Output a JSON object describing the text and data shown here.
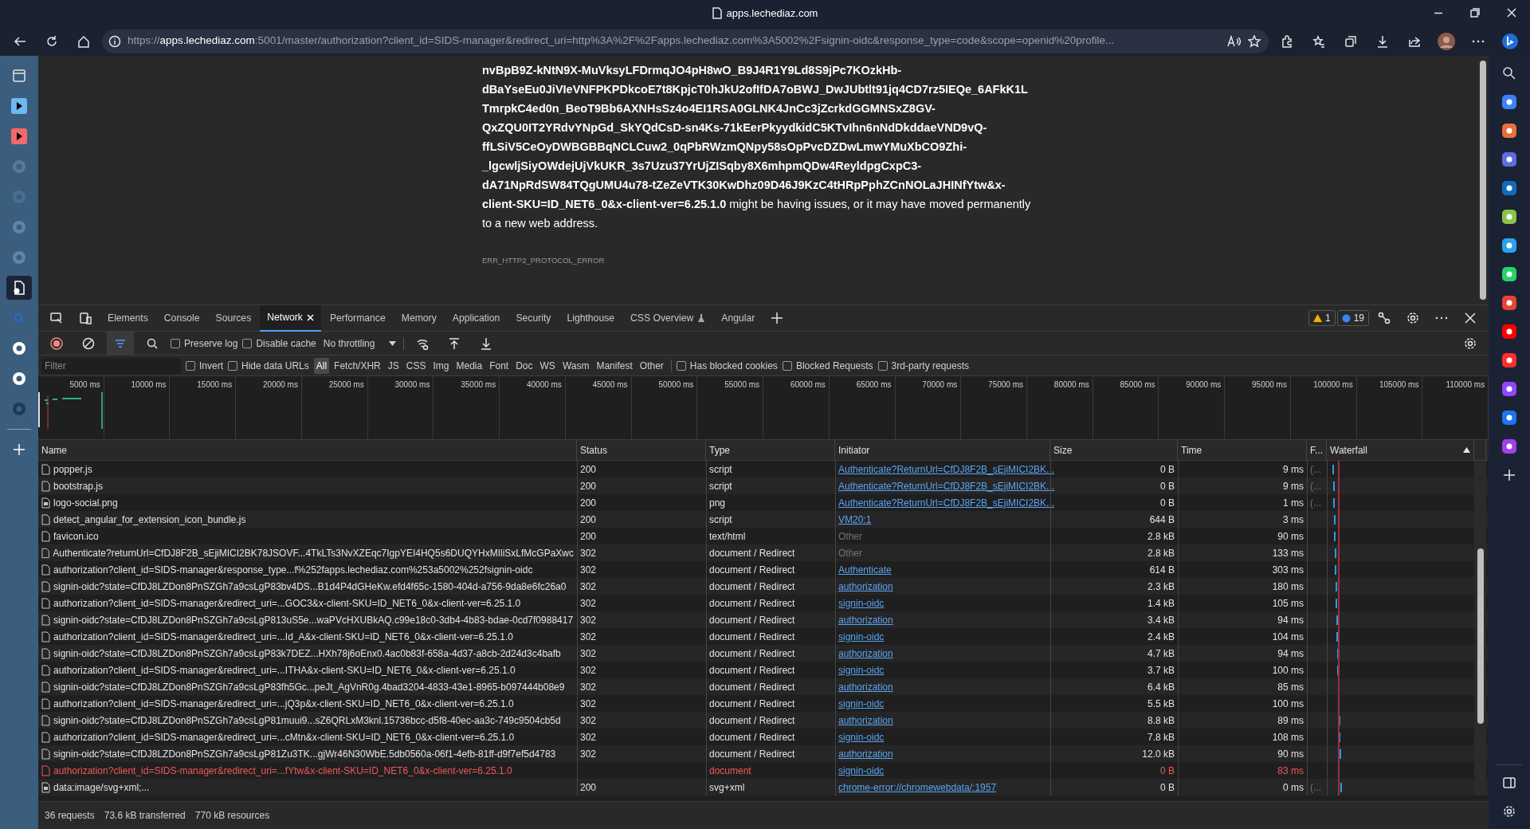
{
  "browser": {
    "title": "apps.lechediaz.com",
    "url_scheme": "https://",
    "url_host": "apps.lechediaz.com",
    "url_rest": ":5001/master/authorization?client_id=SIDS-manager&redirect_uri=http%3A%2F%2Fapps.lechediaz.com%3A5002%2Fsignin-oidc&response_type=code&scope=openid%20profile..."
  },
  "left_sidebar": {
    "items": [
      {
        "kind": "tabs",
        "selected": false
      },
      {
        "kind": "play",
        "color": "#6cb8f0",
        "selected": false
      },
      {
        "kind": "play",
        "color": "#f06a6a",
        "selected": false
      },
      {
        "kind": "app",
        "color": "#5c7a98",
        "selected": false
      },
      {
        "kind": "app",
        "color": "#4a6f94",
        "selected": false
      },
      {
        "kind": "app",
        "color": "#5a86b0",
        "selected": false
      },
      {
        "kind": "app",
        "color": "#5a86b0",
        "selected": false
      },
      {
        "kind": "document",
        "selected": true
      },
      {
        "kind": "search",
        "selected": false
      },
      {
        "kind": "app",
        "color": "#ffffff",
        "selected": false
      },
      {
        "kind": "app",
        "color": "#ffffff",
        "selected": false
      },
      {
        "kind": "app",
        "color": "#1e3a54",
        "selected": false
      }
    ]
  },
  "right_sidebar": {
    "items": [
      {
        "kind": "search"
      },
      {
        "kind": "app",
        "color": "#3b82f6"
      },
      {
        "kind": "app",
        "color": "#e8703a"
      },
      {
        "kind": "app",
        "color": "#5b6ee1"
      },
      {
        "kind": "app",
        "color": "#0f6cbd"
      },
      {
        "kind": "app",
        "color": "#8bc34a"
      },
      {
        "kind": "app",
        "color": "#2aa3ef"
      },
      {
        "kind": "app",
        "color": "#25d366"
      },
      {
        "kind": "app",
        "color": "#ea4335"
      },
      {
        "kind": "app",
        "color": "#ff0000"
      },
      {
        "kind": "app",
        "color": "#ff2d2d"
      },
      {
        "kind": "app",
        "color": "#9146ff"
      },
      {
        "kind": "app",
        "color": "#1877f2"
      },
      {
        "kind": "app",
        "color": "#a040f0"
      },
      {
        "kind": "plus"
      }
    ]
  },
  "page": {
    "message": "**nvBpB9Z-kNtN9X-MuVksyLFDrmqJO4pH8wO_B9J4R1Y9Ld8S9jPc7KOzkHb-dBaYseEu0JiVIeVNFPKPDkcoE7t8KpjcT0hJkU2ofIfDA7oBWJ_DwJUbtlt91jq4CD7rz5IEQe_6AFkK1LTmrpkC4ed0n_BeoT9Bb6AXNHsSz4o4EI1RSA0GLNK4JnCc3jZcrkdGGMNSxZ8GV-QxZQU0IT2YRdvYNpGd_SkYQdCsD-sn4Ks-71kEerPkyydkidC5KTvIhn6nNdDkddaeVND9vQ-ffLSiV5CeOyDWBGBBqNCLCuw2_0qPbRWzmQNpy58sOpPvcDZDwLmwYMuXbCO9Zhi-_lgcwljSiyOWdejUjVkUKR_3s7Uzu37YrUjZISqby8X6mhpmQDw4ReyldpgCxpC3-dA71NpRdSW84TQgUMU4u78-tZeZeVTK30KwDhz09D46J9KzC4tHRpPphZCnNOLaJHINfYtw&x-client-SKU=ID_NET6_0&x-client-ver=6.25.1.0** might be having issues, or it may have moved permanently to a new web address.",
    "error_code": "ERR_HTTP2_PROTOCOL_ERROR"
  },
  "devtools": {
    "tabs": [
      {
        "label": "Elements",
        "selected": false
      },
      {
        "label": "Console",
        "selected": false
      },
      {
        "label": "Sources",
        "selected": false
      },
      {
        "label": "Network",
        "selected": true
      },
      {
        "label": "Performance",
        "selected": false
      },
      {
        "label": "Memory",
        "selected": false
      },
      {
        "label": "Application",
        "selected": false
      },
      {
        "label": "Security",
        "selected": false
      },
      {
        "label": "Lighthouse",
        "selected": false
      },
      {
        "label": "CSS Overview",
        "selected": false,
        "kind": "experimental"
      },
      {
        "label": "Angular",
        "selected": false
      }
    ],
    "warnings": "1",
    "messages": "19",
    "toolbar": {
      "recording": true,
      "preserve_log": false,
      "disable_cache": false,
      "labels": [
        "Preserve log",
        "Disable cache"
      ],
      "throttling": "No throttling"
    },
    "filter": {
      "placeholder": "Filter",
      "invert": false,
      "hide_data_urls": false,
      "types": [
        {
          "label": "All",
          "selected": true
        },
        {
          "label": "Fetch/XHR",
          "selected": false
        },
        {
          "label": "JS",
          "selected": false
        },
        {
          "label": "CSS",
          "selected": false
        },
        {
          "label": "Img",
          "selected": false
        },
        {
          "label": "Media",
          "selected": false
        },
        {
          "label": "Font",
          "selected": false
        },
        {
          "label": "Doc",
          "selected": false
        },
        {
          "label": "WS",
          "selected": false
        },
        {
          "label": "Wasm",
          "selected": false
        },
        {
          "label": "Manifest",
          "selected": false
        },
        {
          "label": "Other",
          "selected": false
        }
      ],
      "has_blocked_cookies": false,
      "blocked_requests": false,
      "third_party_requests": false,
      "labels": [
        "Invert",
        "Hide data URLs",
        "Has blocked cookies",
        "Blocked Requests",
        "3rd-party requests"
      ]
    },
    "overview_ticks": [
      "5000 ms",
      "10000 ms",
      "15000 ms",
      "20000 ms",
      "25000 ms",
      "30000 ms",
      "35000 ms",
      "40000 ms",
      "45000 ms",
      "50000 ms",
      "55000 ms",
      "60000 ms",
      "65000 ms",
      "70000 ms",
      "75000 ms",
      "80000 ms",
      "85000 ms",
      "90000 ms",
      "95000 ms",
      "100000 ms",
      "105000 ms",
      "110000 ms"
    ],
    "table": {
      "columns": [
        "Name",
        "Status",
        "Type",
        "Initiator",
        "Size",
        "Time",
        "F...",
        "Waterfall"
      ],
      "rows": [
        {
          "kind": "document",
          "name": "popper.js",
          "status": "200",
          "type": "script",
          "initiator": "Authenticate?ReturnUrl=CfDJ8F2B_sEjiMICI2BK...",
          "initiator_link": true,
          "size": "0 B",
          "time": "9 ms",
          "column_7": "(...",
          "error": false
        },
        {
          "kind": "document",
          "name": "bootstrap.js",
          "status": "200",
          "type": "script",
          "initiator": "Authenticate?ReturnUrl=CfDJ8F2B_sEjiMICI2BK...",
          "initiator_link": true,
          "size": "0 B",
          "time": "9 ms",
          "column_7": "(...",
          "error": false
        },
        {
          "kind": "image",
          "name": "logo-social.png",
          "status": "200",
          "type": "png",
          "initiator": "Authenticate?ReturnUrl=CfDJ8F2B_sEjiMICI2BK...",
          "initiator_link": true,
          "size": "0 B",
          "time": "1 ms",
          "column_7": "(...",
          "error": false
        },
        {
          "kind": "document",
          "name": "detect_angular_for_extension_icon_bundle.js",
          "status": "200",
          "type": "script",
          "initiator": "VM20:1",
          "initiator_link": true,
          "size": "644 B",
          "time": "3 ms",
          "error": false
        },
        {
          "kind": "document",
          "name": "favicon.ico",
          "status": "200",
          "type": "text/html",
          "initiator": "Other",
          "initiator_link": false,
          "size": "2.8 kB",
          "time": "90 ms",
          "error": false
        },
        {
          "kind": "document",
          "name": "Authenticate?returnUrl=CfDJ8F2B_sEjiMICI2BK78JSOVF...4TkLTs3NvXZEqc7IgpYEI4HQ5s6DUQYHxMIliSxLfMcGPaXwc",
          "status": "302",
          "type": "document / Redirect",
          "initiator": "Other",
          "initiator_link": false,
          "size": "2.8 kB",
          "time": "133 ms",
          "error": false
        },
        {
          "kind": "document",
          "name": "authorization?client_id=SIDS-manager&response_type...f%252fapps.lechediaz.com%253a5002%252fsignin-oidc",
          "status": "302",
          "type": "document / Redirect",
          "initiator": "Authenticate",
          "initiator_link": true,
          "size": "614 B",
          "time": "303 ms",
          "error": false
        },
        {
          "kind": "document",
          "name": "signin-oidc?state=CfDJ8LZDon8PnSZGh7a9csLgP83bv4DS...B1d4P4dGHeKw.efd4f65c-1580-404d-a756-9da8e6fc26a0",
          "status": "302",
          "type": "document / Redirect",
          "initiator": "authorization",
          "initiator_link": true,
          "size": "2.3 kB",
          "time": "180 ms",
          "error": false
        },
        {
          "kind": "document",
          "name": "authorization?client_id=SIDS-manager&redirect_uri=...GOC3&x-client-SKU=ID_NET6_0&x-client-ver=6.25.1.0",
          "status": "302",
          "type": "document / Redirect",
          "initiator": "signin-oidc",
          "initiator_link": true,
          "size": "1.4 kB",
          "time": "105 ms",
          "error": false
        },
        {
          "kind": "document",
          "name": "signin-oidc?state=CfDJ8LZDon8PnSZGh7a9csLgP813uS5e...waPVcHXUBkAQ.c99e18c0-3db4-4b83-bdae-0cd7f0988417",
          "status": "302",
          "type": "document / Redirect",
          "initiator": "authorization",
          "initiator_link": true,
          "size": "3.4 kB",
          "time": "94 ms",
          "error": false
        },
        {
          "kind": "document",
          "name": "authorization?client_id=SIDS-manager&redirect_uri=...Id_A&x-client-SKU=ID_NET6_0&x-client-ver=6.25.1.0",
          "status": "302",
          "type": "document / Redirect",
          "initiator": "signin-oidc",
          "initiator_link": true,
          "size": "2.4 kB",
          "time": "104 ms",
          "error": false
        },
        {
          "kind": "document",
          "name": "signin-oidc?state=CfDJ8LZDon8PnSZGh7a9csLgP83k7DEZ...HXh78j6oEnx0.4ac0b83f-658a-4d37-a8cb-2d24d3c4bafb",
          "status": "302",
          "type": "document / Redirect",
          "initiator": "authorization",
          "initiator_link": true,
          "size": "4.7 kB",
          "time": "94 ms",
          "error": false
        },
        {
          "kind": "document",
          "name": "authorization?client_id=SIDS-manager&redirect_uri=...ITHA&x-client-SKU=ID_NET6_0&x-client-ver=6.25.1.0",
          "status": "302",
          "type": "document / Redirect",
          "initiator": "signin-oidc",
          "initiator_link": true,
          "size": "3.7 kB",
          "time": "100 ms",
          "error": false
        },
        {
          "kind": "document",
          "name": "signin-oidc?state=CfDJ8LZDon8PnSZGh7a9csLgP83fh5Gc...peJt_AgVnR0g.4bad3204-4833-43e1-8965-b097444b08e9",
          "status": "302",
          "type": "document / Redirect",
          "initiator": "authorization",
          "initiator_link": true,
          "size": "6.4 kB",
          "time": "85 ms",
          "error": false
        },
        {
          "kind": "document",
          "name": "authorization?client_id=SIDS-manager&redirect_uri=...jQ3p&x-client-SKU=ID_NET6_0&x-client-ver=6.25.1.0",
          "status": "302",
          "type": "document / Redirect",
          "initiator": "signin-oidc",
          "initiator_link": true,
          "size": "5.5 kB",
          "time": "100 ms",
          "error": false
        },
        {
          "kind": "document",
          "name": "signin-oidc?state=CfDJ8LZDon8PnSZGh7a9csLgP81muui9...sZ6QRLxM3knl.15736bcc-d5f8-40ec-aa3c-749c9504cb5d",
          "status": "302",
          "type": "document / Redirect",
          "initiator": "authorization",
          "initiator_link": true,
          "size": "8.8 kB",
          "time": "89 ms",
          "error": false
        },
        {
          "kind": "document",
          "name": "authorization?client_id=SIDS-manager&redirect_uri=...cMtn&x-client-SKU=ID_NET6_0&x-client-ver=6.25.1.0",
          "status": "302",
          "type": "document / Redirect",
          "initiator": "signin-oidc",
          "initiator_link": true,
          "size": "7.8 kB",
          "time": "108 ms",
          "error": false
        },
        {
          "kind": "document",
          "name": "signin-oidc?state=CfDJ8LZDon8PnSZGh7a9csLgP81Zu3TK...gjWr46N30WbE.5db0560a-06f1-4efb-81ff-d9f7ef5d4783",
          "status": "302",
          "type": "document / Redirect",
          "initiator": "authorization",
          "initiator_link": true,
          "size": "12.0 kB",
          "time": "90 ms",
          "error": false
        },
        {
          "kind": "document",
          "name": "authorization?client_id=SIDS-manager&redirect_uri=...fYtw&x-client-SKU=ID_NET6_0&x-client-ver=6.25.1.0",
          "type": "document",
          "initiator": "signin-oidc",
          "initiator_link": true,
          "size": "0 B",
          "time": "83 ms",
          "error": true
        },
        {
          "kind": "image",
          "name": "data:image/svg+xml;...",
          "status": "200",
          "type": "svg+xml",
          "initiator": "chrome-error://chromewebdata/:1957",
          "initiator_link": true,
          "size": "0 B",
          "time": "0 ms",
          "column_7": "(...",
          "error": false
        }
      ]
    },
    "status_bar": [
      "36 requests",
      "73.6 kB transferred",
      "770 kB resources"
    ]
  }
}
